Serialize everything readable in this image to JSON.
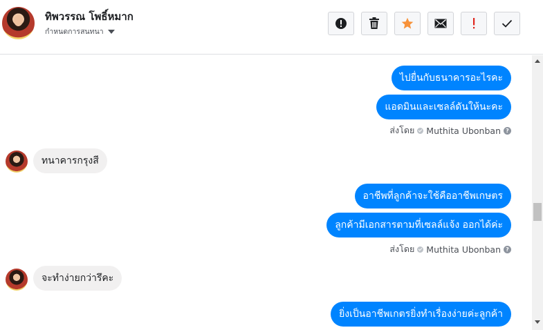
{
  "header": {
    "contact_name": "ทิพวรรณ โพธิ์หมาก",
    "settings_label": "กำหนดการสนทนา",
    "toolbar": {
      "buttons": [
        {
          "name": "spam-button",
          "icon": "alert-circle-icon"
        },
        {
          "name": "delete-button",
          "icon": "trash-icon"
        },
        {
          "name": "star-button",
          "icon": "star-icon",
          "color": "#f7923a"
        },
        {
          "name": "email-button",
          "icon": "envelope-icon"
        },
        {
          "name": "mark-important-button",
          "icon": "exclamation-icon",
          "color": "#e0261e"
        },
        {
          "name": "mark-done-button",
          "icon": "checkmark-icon"
        }
      ]
    }
  },
  "messages": {
    "m1": "ไปยื่นกับธนาคารอะไรคะ",
    "m2": "แอดมินและเซลล์ดันให้นะคะ",
    "sent1_prefix": "ส่งโดย",
    "sent1_name": "Muthita Ubonban",
    "m3": "ทนาคารกรุงสี",
    "m4": "อาชีพที่ลูกค้าจะใช้คืออาชีพเกษตร",
    "m5": "ลูกค้ามีเอกสารตามที่เซลล์แจ้ง ออกได้ค่ะ",
    "sent2_prefix": "ส่งโดย",
    "sent2_name": "Muthita Ubonban",
    "m6": "จะทำง่ายกว่ารึคะ",
    "m7": "ยิ่งเป็นอาชีพเกตรยิ่งทำเรื่องง่ายค่ะลูกค้า"
  },
  "colors": {
    "outgoing": "#0084ff",
    "incoming": "#f1f0f0"
  }
}
